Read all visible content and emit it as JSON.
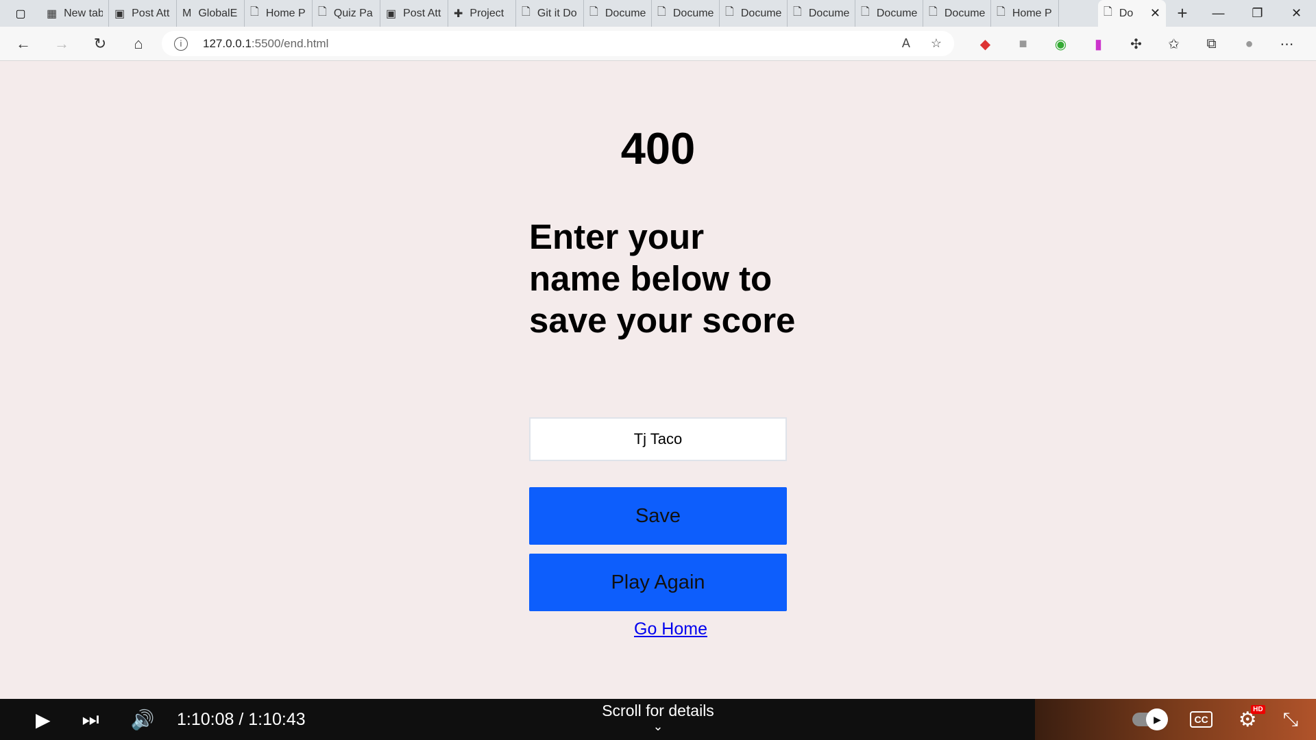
{
  "tabs": [
    {
      "label": "New tab",
      "icon": "newtab-icon"
    },
    {
      "label": "Post Att",
      "icon": "video-icon"
    },
    {
      "label": "GlobalE",
      "icon": "m-icon"
    },
    {
      "label": "Home P",
      "icon": "page-icon"
    },
    {
      "label": "Quiz Pa",
      "icon": "page-icon"
    },
    {
      "label": "Post Att",
      "icon": "video-icon"
    },
    {
      "label": "Project",
      "icon": "sheet-icon"
    },
    {
      "label": "Git it Do",
      "icon": "page-icon"
    },
    {
      "label": "Docume",
      "icon": "page-icon"
    },
    {
      "label": "Docume",
      "icon": "page-icon"
    },
    {
      "label": "Docume",
      "icon": "page-icon"
    },
    {
      "label": "Docume",
      "icon": "page-icon"
    },
    {
      "label": "Docume",
      "icon": "page-icon"
    },
    {
      "label": "Docume",
      "icon": "page-icon"
    },
    {
      "label": "Home P",
      "icon": "page-icon"
    }
  ],
  "active_tab": {
    "label": "Do",
    "close": "✕"
  },
  "address": {
    "host": "127.0.0.1",
    "path": ":5500/end.html"
  },
  "page": {
    "score": "400",
    "prompt": "Enter your name below to save your score",
    "name_value": "Tj Taco",
    "save_label": "Save",
    "play_again_label": "Play Again",
    "home_link": "Go Home"
  },
  "video": {
    "time": "1:10:08 / 1:10:43",
    "scroll_hint": "Scroll for details",
    "hd_badge": "HD",
    "cc_label": "CC"
  },
  "colors": {
    "page_bg": "#f4ebeb",
    "button_bg": "#0d5efc",
    "link": "#0000ee"
  }
}
